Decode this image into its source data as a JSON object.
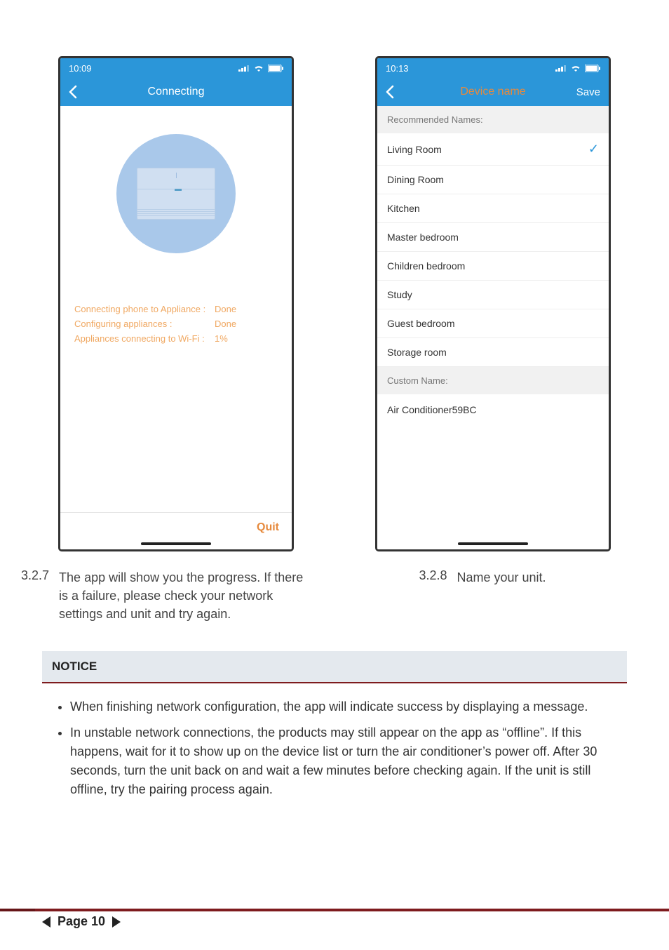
{
  "left_phone": {
    "time": "10:09",
    "title": "Connecting",
    "status": [
      {
        "label": "Connecting phone to Appliance :",
        "value": "Done"
      },
      {
        "label": "Configuring appliances :",
        "value": "Done"
      },
      {
        "label": "Appliances connecting to Wi-Fi :",
        "value": "1%"
      }
    ],
    "quit": "Quit"
  },
  "right_phone": {
    "time": "10:13",
    "title": "Device name",
    "save": "Save",
    "rec_header": "Recommended Names:",
    "names": [
      "Living Room",
      "Dining Room",
      "Kitchen",
      "Master bedroom",
      "Children bedroom",
      "Study",
      "Guest bedroom",
      "Storage room"
    ],
    "selected_index": 0,
    "custom_header": "Custom Name:",
    "custom_value": "Air Conditioner59BC"
  },
  "captions": {
    "left_num": "3.2.7",
    "left_text": "The app will show you the progress. If there is a failure, please check your network settings and unit and try again.",
    "right_num": "3.2.8",
    "right_text": "Name your unit."
  },
  "notice": {
    "heading": "NOTICE",
    "items": [
      "When finishing network configuration, the app will indicate success by displaying a message.",
      "In unstable network connections, the products may still appear on the app as “offline”. If this happens, wait for it to show up on the device list or turn the air conditioner’s power off. After 30 seconds, turn the unit back on and wait a few minutes before checking again. If the unit is still offline, try the pairing process again."
    ]
  },
  "footer": {
    "page_label": "Page 10"
  },
  "icons": {
    "signal": "signal-icon",
    "wifi": "wifi-icon",
    "battery": "battery-icon",
    "back": "chevron-left-icon",
    "check": "check-icon"
  }
}
